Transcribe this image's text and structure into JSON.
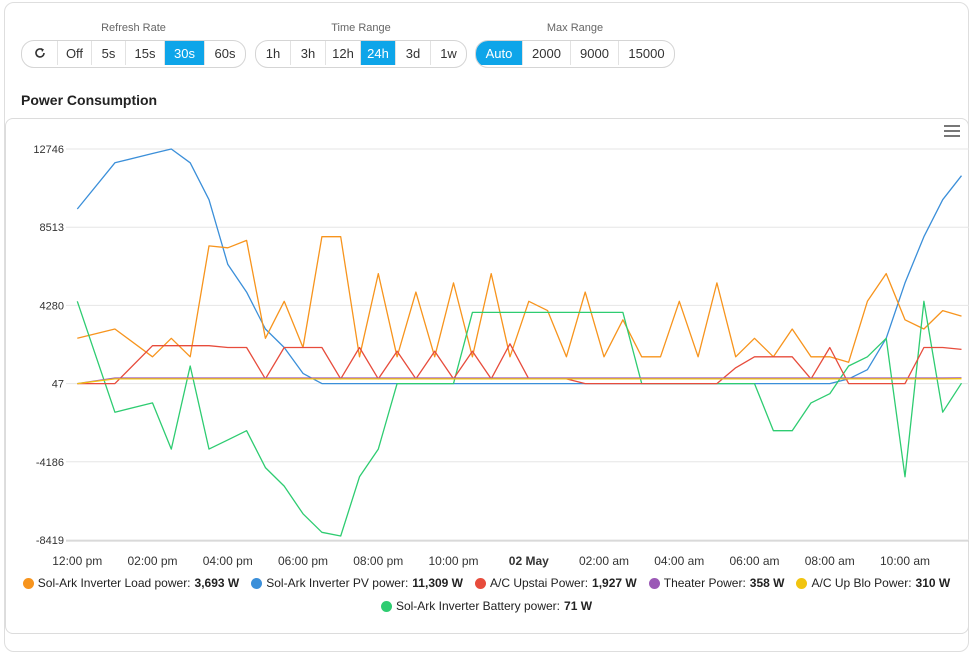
{
  "controls": {
    "refresh": {
      "label": "Refresh Rate",
      "buttons": [
        "Off",
        "5s",
        "15s",
        "30s",
        "60s"
      ],
      "active": "30s"
    },
    "time": {
      "label": "Time Range",
      "buttons": [
        "1h",
        "3h",
        "12h",
        "24h",
        "3d",
        "1w"
      ],
      "active": "24h"
    },
    "max": {
      "label": "Max Range",
      "buttons": [
        "Auto",
        "2000",
        "9000",
        "15000"
      ],
      "active": "Auto"
    }
  },
  "section_title": "Power Consumption",
  "colors": {
    "accent": "#0ea5e9"
  },
  "chart_data": {
    "type": "line",
    "title": "",
    "xlabel": "",
    "ylabel": "",
    "grid": true,
    "legend_position": "bottom",
    "y_ticks": [
      12746,
      8513,
      4280,
      47,
      -4186,
      -8419
    ],
    "ylim": [
      -8419,
      12746
    ],
    "x_ticks": [
      "12:00 pm",
      "02:00 pm",
      "04:00 pm",
      "06:00 pm",
      "08:00 pm",
      "10:00 pm",
      "02 May",
      "02:00 am",
      "04:00 am",
      "06:00 am",
      "08:00 am",
      "10:00 am"
    ],
    "x_hours": [
      0,
      1,
      2,
      2.5,
      3,
      3.5,
      4,
      4.5,
      5,
      5.5,
      6,
      6.5,
      7,
      7.5,
      8,
      8.5,
      9,
      9.5,
      10,
      10.5,
      11,
      11.5,
      12,
      12.5,
      13,
      13.5,
      14,
      14.5,
      15,
      15.5,
      16,
      16.5,
      17,
      17.5,
      18,
      18.5,
      19,
      19.5,
      20,
      20.5,
      21,
      21.5,
      22,
      22.5,
      23,
      23.5
    ],
    "series": [
      {
        "name": "Sol-Ark Inverter Load power",
        "current": "3,693 W",
        "color": "#f7941d",
        "values": [
          2500,
          3000,
          1500,
          2500,
          1500,
          7500,
          7400,
          7800,
          2500,
          4500,
          2000,
          8000,
          8000,
          1500,
          6000,
          1500,
          5000,
          1500,
          5500,
          1500,
          6000,
          1500,
          4500,
          4000,
          1500,
          5000,
          1500,
          3500,
          1500,
          1500,
          4500,
          1500,
          5500,
          1500,
          2500,
          1500,
          3000,
          1500,
          1500,
          1200,
          4500,
          6000,
          3500,
          3000,
          4000,
          3700
        ]
      },
      {
        "name": "Sol-Ark Inverter PV power",
        "current": "11,309 W",
        "color": "#3b8fd9",
        "values": [
          9500,
          12000,
          12500,
          12746,
          12000,
          10000,
          6500,
          5000,
          3000,
          2000,
          600,
          47,
          47,
          47,
          47,
          47,
          47,
          47,
          47,
          47,
          47,
          47,
          47,
          47,
          47,
          47,
          47,
          47,
          47,
          47,
          47,
          47,
          47,
          47,
          47,
          47,
          47,
          47,
          47,
          300,
          800,
          2500,
          5500,
          8000,
          10000,
          11300
        ]
      },
      {
        "name": "A/C Upstai Power",
        "current": "1,927 W",
        "color": "#e74c3c",
        "values": [
          47,
          47,
          2100,
          2100,
          2100,
          2100,
          2000,
          2000,
          300,
          2000,
          2000,
          2000,
          300,
          2000,
          300,
          1800,
          300,
          1800,
          300,
          1800,
          300,
          2200,
          300,
          300,
          300,
          47,
          47,
          47,
          47,
          47,
          47,
          47,
          47,
          900,
          1500,
          1500,
          1500,
          300,
          2000,
          47,
          47,
          47,
          47,
          2000,
          2000,
          1900
        ]
      },
      {
        "name": "Theater Power",
        "current": "358 W",
        "color": "#9b59b6",
        "values": [
          47,
          350,
          350,
          350,
          350,
          350,
          350,
          350,
          350,
          350,
          350,
          350,
          350,
          350,
          350,
          350,
          350,
          350,
          350,
          350,
          350,
          350,
          350,
          350,
          350,
          350,
          350,
          350,
          350,
          350,
          350,
          350,
          350,
          350,
          350,
          350,
          350,
          350,
          350,
          350,
          350,
          350,
          350,
          350,
          350,
          358
        ]
      },
      {
        "name": "A/C Up Blo Power",
        "current": "310 W",
        "color": "#f1c40f",
        "values": [
          47,
          300,
          300,
          300,
          300,
          300,
          300,
          300,
          300,
          300,
          300,
          300,
          300,
          300,
          300,
          300,
          300,
          300,
          300,
          300,
          300,
          300,
          300,
          300,
          300,
          300,
          300,
          300,
          300,
          300,
          300,
          300,
          300,
          300,
          300,
          300,
          300,
          300,
          300,
          300,
          300,
          300,
          300,
          300,
          300,
          310
        ]
      },
      {
        "name": "Sol-Ark Inverter Battery power",
        "current": "71 W",
        "color": "#2ecc71",
        "values": [
          4500,
          -1500,
          -1000,
          -3500,
          1000,
          -3500,
          -3000,
          -2500,
          -4500,
          -5500,
          -7000,
          -8000,
          -8200,
          -5000,
          -3500,
          47,
          47,
          47,
          47,
          3900,
          3900,
          3900,
          3900,
          3900,
          3900,
          3900,
          3900,
          3900,
          47,
          47,
          47,
          47,
          47,
          47,
          47,
          -2500,
          -2500,
          -1000,
          -500,
          1000,
          1500,
          2500,
          -5000,
          4500,
          -1500,
          71
        ]
      }
    ]
  }
}
